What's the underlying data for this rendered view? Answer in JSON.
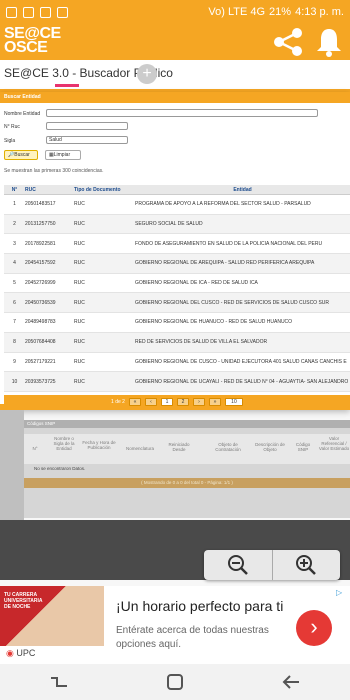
{
  "status": {
    "time": "4:13 p. m.",
    "battery": "21%",
    "net": "Vo) LTE 4G"
  },
  "header": {
    "logo_line1": "SE@CE",
    "logo_line2": "OSCE",
    "tab_label": "SE@CE 3.0 - Buscador Público",
    "tab_add": "+"
  },
  "modal": {
    "title": "Buscar Entidad",
    "form": {
      "nombre_label": "Nombre Entidad",
      "nombre_value": "",
      "ruc_label": "N° Ruc",
      "ruc_value": "",
      "sigla_label": "Sigla",
      "sigla_value": "Salud",
      "buscar_label": "Buscar",
      "limpiar_label": "Limpiar"
    },
    "coincidencias": "Se muestran las primeras 300 coincidencias.",
    "columns": [
      "N°",
      "RUC",
      "Tipo de Documento",
      "Entidad"
    ],
    "rows": [
      [
        "1",
        "20501483517",
        "RUC",
        "PROGRAMA DE APOYO A LA REFORMA DEL SECTOR SALUD - PARSALUD"
      ],
      [
        "2",
        "20131257750",
        "RUC",
        "SEGURO SOCIAL DE SALUD"
      ],
      [
        "3",
        "20178922581",
        "RUC",
        "FONDO DE ASEGURAMIENTO EN SALUD DE LA POLICIA NACIONAL DEL PERU"
      ],
      [
        "4",
        "20454157592",
        "RUC",
        "GOBIERNO REGIONAL DE AREQUIPA - SALUD RED PERIFERICA AREQUIPA"
      ],
      [
        "5",
        "20452726999",
        "RUC",
        "GOBIERNO REGIONAL DE ICA - RED DE SALUD ICA"
      ],
      [
        "6",
        "20450736539",
        "RUC",
        "GOBIERNO REGIONAL DEL CUSCO - RED DE SERVICIOS DE SALUD CUSCO SUR"
      ],
      [
        "7",
        "20489498783",
        "RUC",
        "GOBIERNO REGIONAL DE HUANUCO - RED DE SALUD HUANUCO"
      ],
      [
        "8",
        "20507684408",
        "RUC",
        "RED DE SERVICIOS DE SALUD DE VILLA EL SALVADOR"
      ],
      [
        "9",
        "20527179221",
        "RUC",
        "GOBIERNO REGIONAL DE CUSCO - UNIDAD EJECUTORA 401 SALUD CANAS CANCHIS E"
      ],
      [
        "10",
        "20393573725",
        "RUC",
        "GOBIERNO REGIONAL DE UCAYALI - RED DE SALUD N° 04 - AGUAYTIA- SAN ALEJANDRO"
      ]
    ],
    "pager": {
      "label": "1 de 2",
      "first": "«",
      "prev": "‹",
      "page1": "1",
      "page2": "2",
      "next": "›",
      "last": "»",
      "page_size": "10"
    }
  },
  "background": {
    "title": "Códigos SNIP",
    "columns": [
      "N°",
      "Nombre o Sigla de la Entidad",
      "Fecha y Hora de Publicación",
      "Nomenclatura",
      "Reiniciado Desde",
      "Objeto de Contratación",
      "Descripción de Objeto",
      "Código SNIP",
      "Valor Referencial / Valor Estimado"
    ],
    "nodata": "No se encontraron Datos.",
    "footer": "( Mostrando de 0 a 0 del total 0 - Página: 1/1 )"
  },
  "ad": {
    "photo_text": "TU CARRERA UNIVERSITARIA DE NOCHE",
    "title": "¡Un horario perfecto para ti",
    "body": "Entérate acerca de todas nuestras opciones aquí.",
    "brand": "UPC",
    "arrow": "›"
  },
  "colors": {
    "accent": "#f5a623",
    "pink": "#e8336e",
    "ad_red": "#e53935"
  }
}
